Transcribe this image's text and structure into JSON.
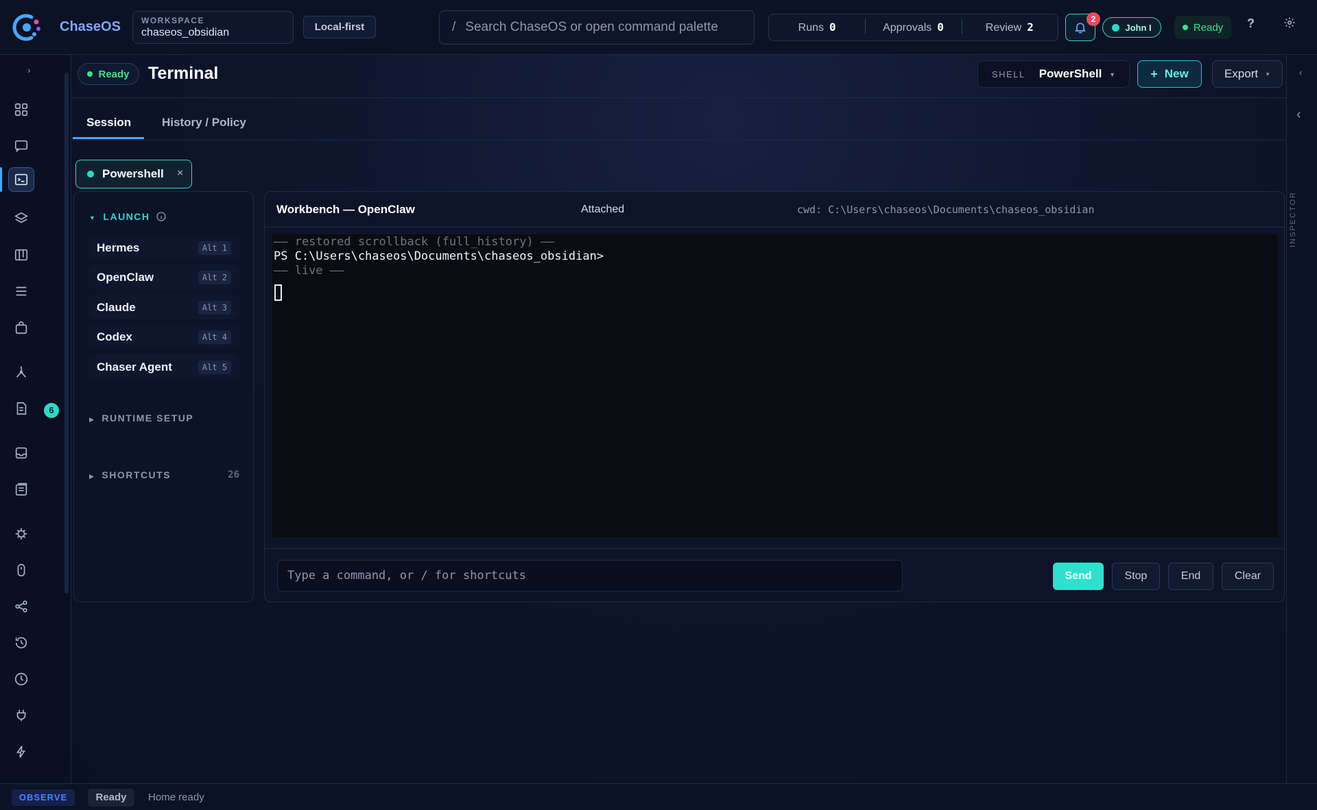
{
  "app": {
    "name": "ChaseOS"
  },
  "workspace": {
    "label": "WORKSPACE",
    "value": "chaseos_obsidian"
  },
  "mode_pill": "Local-first",
  "search": {
    "prefix": "/",
    "placeholder": "Search ChaseOS or open command palette"
  },
  "stats": [
    {
      "label": "Runs",
      "value": "0"
    },
    {
      "label": "Approvals",
      "value": "0"
    },
    {
      "label": "Review",
      "value": "2"
    }
  ],
  "notifications": {
    "count": "2",
    "icon": "bell-icon"
  },
  "user": {
    "name": "John I"
  },
  "status": {
    "label": "Ready",
    "color": "#3ee28e"
  },
  "header": {
    "status": "Ready",
    "title": "Terminal",
    "shell_label": "SHELL",
    "shell_value": "PowerShell",
    "new_label": "New",
    "export_label": "Export"
  },
  "inspector": {
    "label": "INSPECTOR"
  },
  "tabs": [
    {
      "label": "Session",
      "active": true
    },
    {
      "label": "History / Policy",
      "active": false
    }
  ],
  "session_chip": {
    "label": "Powershell"
  },
  "launch": {
    "title": "LAUNCH",
    "items": [
      {
        "name": "Hermes",
        "shortcut": "Alt 1"
      },
      {
        "name": "OpenClaw",
        "shortcut": "Alt 2"
      },
      {
        "name": "Claude",
        "shortcut": "Alt 3"
      },
      {
        "name": "Codex",
        "shortcut": "Alt 4"
      },
      {
        "name": "Chaser Agent",
        "shortcut": "Alt 5"
      }
    ],
    "runtime_setup": "RUNTIME SETUP",
    "shortcuts": "SHORTCUTS",
    "shortcuts_count": "26"
  },
  "terminal": {
    "title": "Workbench — OpenClaw",
    "status": "Attached",
    "cwd": "cwd: C:\\Users\\chaseos\\Documents\\chaseos_obsidian",
    "lines": [
      "—— restored scrollback (full_history) ——",
      "PS C:\\Users\\chaseos\\Documents\\chaseos_obsidian>",
      "—— live ——"
    ],
    "input_placeholder": "Type a command, or / for shortcuts",
    "send_label": "Send",
    "stop_label": "Stop",
    "end_label": "End",
    "clear_label": "Clear"
  },
  "rail": {
    "items": [
      "dashboard-icon",
      "chat-icon",
      "terminal-icon",
      "layers-icon",
      "board-icon",
      "list-icon",
      "bag-icon",
      "graph-icon",
      "document-icon",
      "inbox-icon",
      "notes-icon",
      "cpu-icon",
      "mouse-icon",
      "share-icon",
      "history-icon",
      "clock-icon",
      "plug-icon",
      "bolt-icon"
    ],
    "document_badge": "6"
  },
  "footer": {
    "mode": "OBSERVE",
    "status": "Ready",
    "message": "Home ready"
  },
  "colors": {
    "accent": "#2fd8c6",
    "brand": "#4aa6ff",
    "ready": "#3ee28e",
    "alert": "#e84a5f"
  }
}
